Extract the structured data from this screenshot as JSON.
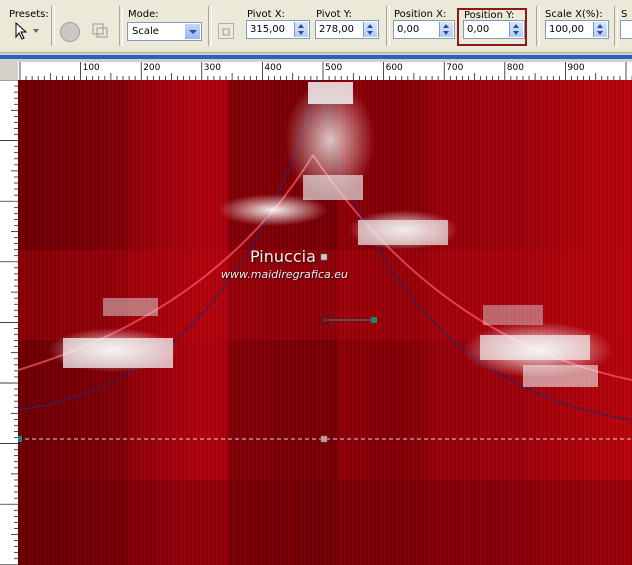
{
  "toolbar": {
    "presets_label": "Presets:",
    "mode_label": "Mode:",
    "mode_value": "Scale",
    "pivot_x_label": "Pivot X:",
    "pivot_x_value": "315,00",
    "pivot_y_label": "Pivot Y:",
    "pivot_y_value": "278,00",
    "position_x_label": "Position X:",
    "position_x_value": "0,00",
    "position_y_label": "Position Y:",
    "position_y_value": "0,00",
    "scale_x_label": "Scale X(%):",
    "scale_x_value": "100,00",
    "cut_label": "S"
  },
  "ruler": {
    "labels": [
      "100",
      "200",
      "300",
      "400",
      "500",
      "600",
      "700",
      "800",
      "900"
    ]
  },
  "canvas": {
    "watermark_title": "Pinuccia",
    "watermark_url": "www.maidiregrafica.eu"
  },
  "colors": {
    "canvas": "#9a0208",
    "highlight": "#8b1a1a",
    "handle": "#2e7d7d"
  }
}
